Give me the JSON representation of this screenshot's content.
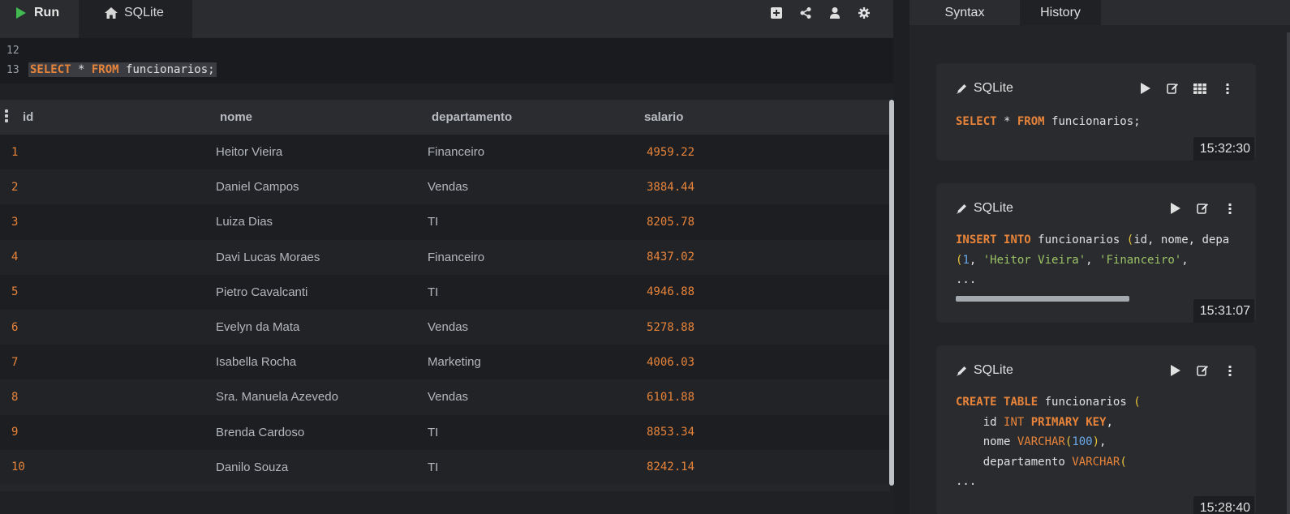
{
  "toolbar": {
    "run_label": "Run",
    "tab_label": "SQLite",
    "icons": [
      "add-box-icon",
      "share-icon",
      "user-icon",
      "gear-icon"
    ]
  },
  "editor": {
    "lines": [
      {
        "number": "12",
        "code": ""
      },
      {
        "number": "13",
        "code": "SELECT * FROM funcionarios;"
      }
    ]
  },
  "results": {
    "columns": [
      "id",
      "nome",
      "departamento",
      "salario"
    ],
    "rows": [
      {
        "id": "1",
        "nome": "Heitor Vieira",
        "departamento": "Financeiro",
        "salario": "4959.22"
      },
      {
        "id": "2",
        "nome": "Daniel Campos",
        "departamento": "Vendas",
        "salario": "3884.44"
      },
      {
        "id": "3",
        "nome": "Luiza Dias",
        "departamento": "TI",
        "salario": "8205.78"
      },
      {
        "id": "4",
        "nome": "Davi Lucas Moraes",
        "departamento": "Financeiro",
        "salario": "8437.02"
      },
      {
        "id": "5",
        "nome": "Pietro Cavalcanti",
        "departamento": "TI",
        "salario": "4946.88"
      },
      {
        "id": "6",
        "nome": "Evelyn da Mata",
        "departamento": "Vendas",
        "salario": "5278.88"
      },
      {
        "id": "7",
        "nome": "Isabella Rocha",
        "departamento": "Marketing",
        "salario": "4006.03"
      },
      {
        "id": "8",
        "nome": "Sra. Manuela Azevedo",
        "departamento": "Vendas",
        "salario": "6101.88"
      },
      {
        "id": "9",
        "nome": "Brenda Cardoso",
        "departamento": "TI",
        "salario": "8853.34"
      },
      {
        "id": "10",
        "nome": "Danilo Souza",
        "departamento": "TI",
        "salario": "8242.14"
      }
    ]
  },
  "right_panel": {
    "tabs": [
      "Syntax",
      "History"
    ],
    "history": [
      {
        "engine": "SQLite",
        "time": "15:32:30",
        "code_lines": [
          "SELECT * FROM funcionarios;"
        ]
      },
      {
        "engine": "SQLite",
        "time": "15:31:07",
        "code_lines": [
          "INSERT INTO funcionarios (id, nome, depa",
          "(1, 'Heitor Vieira', 'Financeiro',",
          "..."
        ]
      },
      {
        "engine": "SQLite",
        "time": "15:28:40",
        "code_lines": [
          "CREATE TABLE funcionarios (",
          "    id INT PRIMARY KEY,",
          "    nome VARCHAR(100),",
          "    departamento VARCHAR(",
          "..."
        ]
      }
    ]
  },
  "colors": {
    "accent_orange": "#e8843a",
    "run_green": "#3fb950",
    "string_green": "#9bc266",
    "number_blue": "#6ba8e8"
  }
}
